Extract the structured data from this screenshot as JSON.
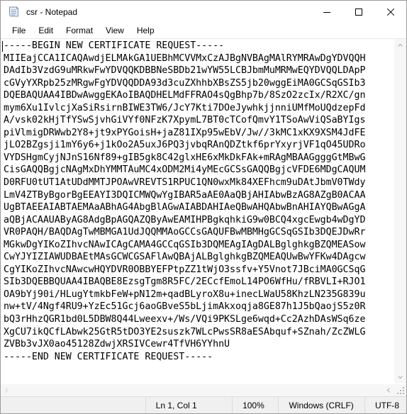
{
  "window": {
    "title": "csr - Notepad",
    "app_icon": "notepad-icon"
  },
  "window_controls": {
    "minimize": "minimize-icon",
    "maximize": "maximize-icon",
    "close": "close-icon"
  },
  "menu": {
    "items": [
      {
        "label": "File"
      },
      {
        "label": "Edit"
      },
      {
        "label": "Format"
      },
      {
        "label": "View"
      },
      {
        "label": "Help"
      }
    ]
  },
  "document": {
    "lines": [
      "-----BEGIN NEW CERTIFICATE REQUEST-----",
      "MIIEajCCA1ICAQAwdjELMAkGA1UEBhMCVVMxCzAJBgNVBAgMAlRYMRAwDgYDVQQH",
      "DAdIb3VzdG9uMRkwFwYDVQQKDBBNeSBDb21wYW55LCBJbmMuMRMwEQYDVQQLDApP",
      "cGVyYXRpb25zMRgwFgYDVQQDDA93d3cuZXhhbXBsZS5jb20wggEiMA0GCSqGSIb3",
      "DQEBAQUAA4IBDwAwggEKAoIBAQDHELMdFFRAO4sQgBhp7b/8SzO2zcIx/R2XC/gn",
      "mym6Xu1IvlcjXaSiRsirnBIWE3TW6/JcY7Kti7DOeJywhkjjnniUMfMoUQdzepFd",
      "A/vsk02kHjTfYSwSjvhGiVYf0NFzK7XpymL7BT0cTCofQmvY1TSoAwViQSaBYIgs",
      "piVlmigDRWwb2Y8+jt9xPYGoisH+jaZ81IXp95wEbV/Jw//3kMC1xKX9XSM4JdFE",
      "jLO2BZgsji1mY6y6+j1kOo2A5uxJ6PQ3jvbqRAnQDZtkf6prYxyrjVF1qO45UDRo",
      "VYDSHgmCyjNJnS16Nf89+gIB5gk8C42glxHE6xMkDkFAk+mRAgMBAAGgggGtMBwG",
      "CisGAQQBgjcNAgMxDhYMMTAuMC4xODM2Mi4yMEcGCSsGAQQBgjcVFDE6MDgCAQUM",
      "D0RFU0tUT1AtUDdMMTJPOAwVREVTS1RPUC1QN0wxMk84XEFhcm9uDAtJbmV0TWdy",
      "LmV4ZTByBgorBgEEAYI3DQICMWQwYgIBAR5aAE0AaQBjAHIAbwBzAG8AZgB0ACAA",
      "UgBTAEEAIABTAEMAaABhAG4AbgBlAGwAIABDAHIAeQBwAHQAbwBnAHIAYQBwAGgA",
      "aQBjACAAUAByAG8AdgBpAGQAZQByAwEAMIHPBgkqhkiG9w0BCQ4xgcEwgb4wDgYD",
      "VR0PAQH/BAQDAgTwMBMGA1UdJQQMMAoGCCsGAQUFBwMBMHgGCSqGSIb3DQEJDwRr",
      "MGkwDgYIKoZIhvcNAwICAgCAMA4GCCqGSIb3DQMEAgIAgDALBglghkgBZQMEASow",
      "CwYJYIZIAWUDBAEtMAsGCWCGSAFlAwQBAjALBglghkgBZQMEAQUwBwYFKw4DAgcw",
      "CgYIKoZIhvcNAwcwHQYDVR0OBBYEFPtpZZ1tWjO3ssfv+Y5Vnot7JBciMA0GCSqG",
      "SIb3DQEBBQUAA4IBAQBE8EzsgTgm8R5FC/2ECcfEmoL14PO6WfHu/fRBVLI+RJO1",
      "OA9bYj90i/HLugYtmkbFeW+pN12m+qadBLyroX8u+inecLWaU58KhzLN235G839u",
      "nw+tV/4Ngf4RU9+YzEc51Gcj6aoGBveS5bLjimAkxoqja8GE87h1J5bQaojS5z0R",
      "bQ3rHhzQGR1bd0L5DBW8Q44Lweexv+/Ws/VQi9PKSLge6wqd+Cc2AzhDAsWSq6ze",
      "XgCU7ikQCfLAbwk25GtR5tDO3YE2suszk7WLcPwsSR8aESAbquf+SZnah/ZcZWLG",
      "ZVBb3vJX0ao45128ZdwjXRSIVCewr4TfVH6YYhnU",
      "-----END NEW CERTIFICATE REQUEST-----"
    ]
  },
  "scrollbars": {
    "vertical_up": "chevron-up-icon",
    "vertical_down": "chevron-down-icon",
    "horizontal_right": "chevron-right-icon"
  },
  "statusbar": {
    "position": "Ln 1, Col 1",
    "zoom": "100%",
    "line_ending": "Windows (CRLF)",
    "encoding": "UTF-8"
  },
  "colors": {
    "window_border": "#9a9a9a",
    "titlebar_bg": "#ffffff",
    "statusbar_bg": "#f0f0f0",
    "scrollbar_bg": "#f6f6f6",
    "text": "#000000"
  }
}
